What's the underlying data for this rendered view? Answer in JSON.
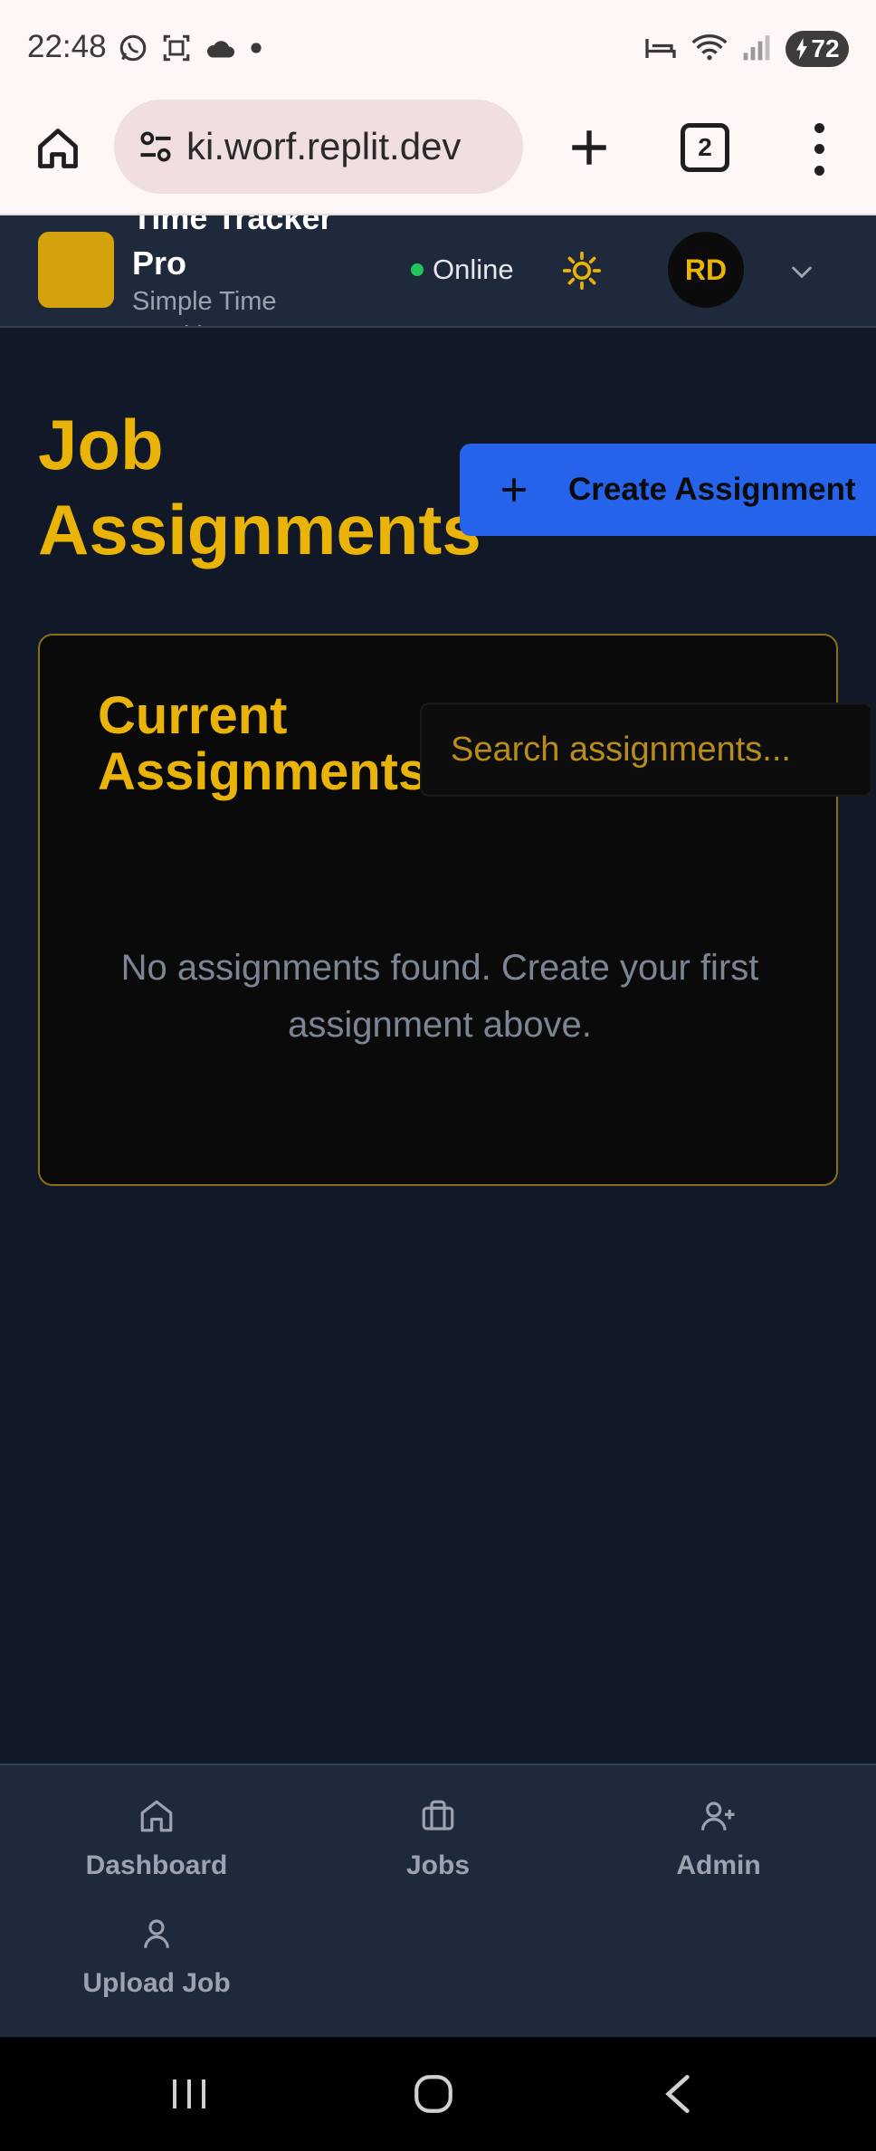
{
  "status_bar": {
    "time": "22:48",
    "battery": "72",
    "icons": [
      "whatsapp-icon",
      "screenshot-icon",
      "cloud-icon",
      "dot-icon",
      "sleep-icon",
      "wifi-icon",
      "signal-icon",
      "battery-icon"
    ]
  },
  "browser": {
    "url": "ki.worf.replit.dev",
    "tab_count": "2"
  },
  "header": {
    "app_name": "Time Tracker Pro",
    "app_subtitle": "Simple Time Tracking",
    "status": "Online",
    "avatar_initials": "RD"
  },
  "main": {
    "title": "Job Assignments",
    "create_button": "Create Assignment",
    "card": {
      "title": "Current Assignments",
      "search_placeholder": "Search assignments...",
      "empty_message": "No assignments found. Create your first assignment above."
    }
  },
  "bottom_nav": {
    "items": [
      {
        "label": "Dashboard",
        "icon": "home-icon"
      },
      {
        "label": "Jobs",
        "icon": "briefcase-icon"
      },
      {
        "label": "Admin",
        "icon": "user-plus-icon"
      },
      {
        "label": "Upload Job",
        "icon": "user-icon"
      }
    ]
  },
  "colors": {
    "accent": "#eab308",
    "primary_button": "#2563eb",
    "background": "#111827",
    "header": "#1e293b",
    "online": "#22c55e"
  }
}
